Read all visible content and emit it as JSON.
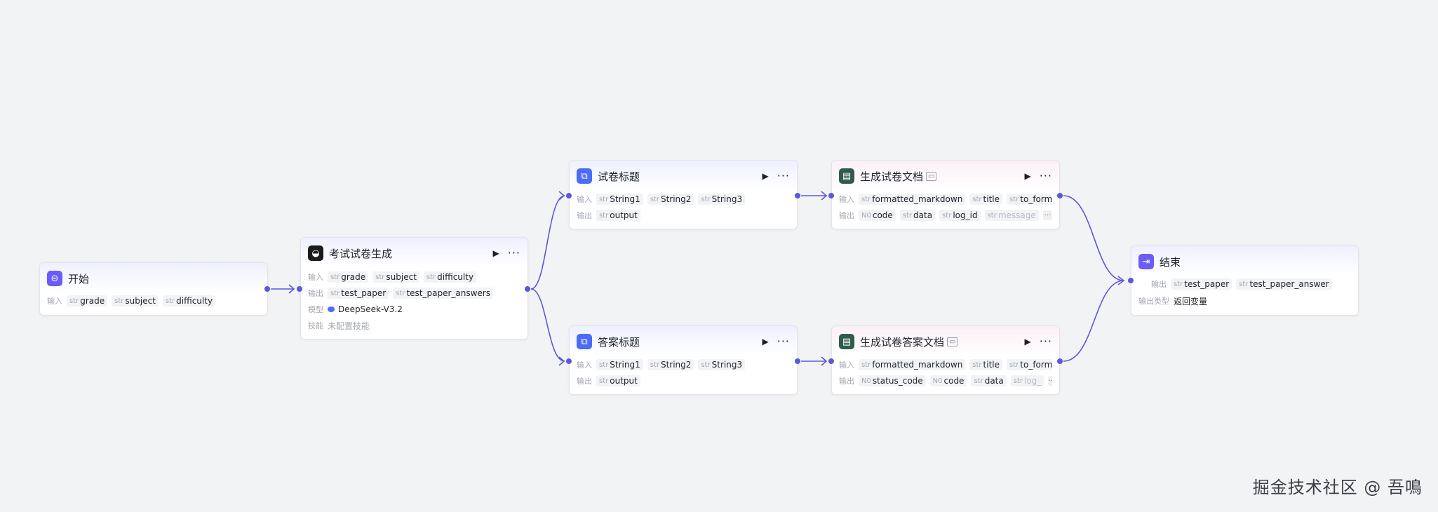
{
  "nodes": {
    "start": {
      "title": "开始",
      "input_label": "输入",
      "inputs": [
        {
          "type": "str",
          "name": "grade"
        },
        {
          "type": "str",
          "name": "subject"
        },
        {
          "type": "str",
          "name": "difficulty"
        }
      ]
    },
    "exam": {
      "title": "考试试卷生成",
      "input_label": "输入",
      "inputs": [
        {
          "type": "str",
          "name": "grade"
        },
        {
          "type": "str",
          "name": "subject"
        },
        {
          "type": "str",
          "name": "difficulty"
        }
      ],
      "output_label": "输出",
      "outputs": [
        {
          "type": "str",
          "name": "test_paper"
        },
        {
          "type": "str",
          "name": "test_paper_answers"
        }
      ],
      "model_label": "模型",
      "model": "DeepSeek-V3.2",
      "skill_label": "技能",
      "skill": "未配置技能"
    },
    "paper_title": {
      "title": "试卷标题",
      "input_label": "输入",
      "inputs": [
        {
          "type": "str",
          "name": "String1"
        },
        {
          "type": "str",
          "name": "String2"
        },
        {
          "type": "str",
          "name": "String3"
        }
      ],
      "output_label": "输出",
      "outputs": [
        {
          "type": "str",
          "name": "output"
        }
      ]
    },
    "answer_title": {
      "title": "答案标题",
      "input_label": "输入",
      "inputs": [
        {
          "type": "str",
          "name": "String1"
        },
        {
          "type": "str",
          "name": "String2"
        },
        {
          "type": "str",
          "name": "String3"
        }
      ],
      "output_label": "输出",
      "outputs": [
        {
          "type": "str",
          "name": "output"
        }
      ]
    },
    "gen_paper_doc": {
      "title": "生成试卷文档",
      "input_label": "输入",
      "inputs": [
        {
          "type": "str",
          "name": "formatted_markdown"
        },
        {
          "type": "str",
          "name": "title"
        },
        {
          "type": "str",
          "name": "to_format"
        }
      ],
      "output_label": "输出",
      "outputs": [
        {
          "type": "N0",
          "name": "code"
        },
        {
          "type": "str",
          "name": "data"
        },
        {
          "type": "str",
          "name": "log_id"
        },
        {
          "type": "str",
          "name": "message"
        }
      ],
      "more": "···"
    },
    "gen_answer_doc": {
      "title": "生成试卷答案文档",
      "input_label": "输入",
      "inputs": [
        {
          "type": "str",
          "name": "formatted_markdown"
        },
        {
          "type": "str",
          "name": "title"
        },
        {
          "type": "str",
          "name": "to_format"
        }
      ],
      "output_label": "输出",
      "outputs": [
        {
          "type": "N0",
          "name": "status_code"
        },
        {
          "type": "N0",
          "name": "code"
        },
        {
          "type": "str",
          "name": "data"
        },
        {
          "type": "str",
          "name": "log_"
        }
      ],
      "more": "···"
    },
    "end": {
      "title": "结束",
      "output_label": "输出",
      "outputs": [
        {
          "type": "str",
          "name": "test_paper"
        },
        {
          "type": "str",
          "name": "test_paper_answer"
        }
      ],
      "output_type_label": "输出类型",
      "output_type": "返回变量"
    }
  },
  "actions": {
    "run": "▶",
    "more": "···"
  },
  "watermark": "掘金技术社区 @ 吾鳴",
  "colors": {
    "edge": "#5a59d8",
    "background": "#f2f3f5",
    "node_border": "#e3e5ea"
  }
}
